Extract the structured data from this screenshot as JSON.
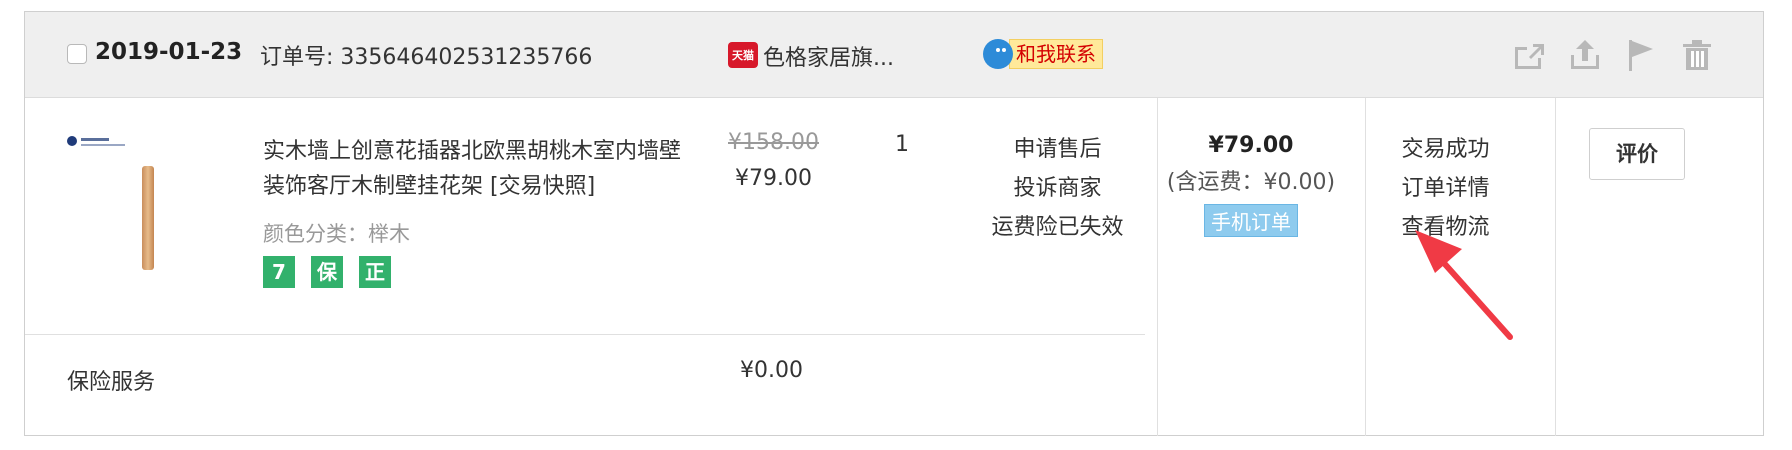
{
  "order": {
    "date": "2019-01-23",
    "order_number_text": "订单号: 335646402531235766",
    "shop_badge": "天猫",
    "shop_name": "色格家居旗...",
    "contact_label": "和我联系",
    "header_icons": [
      "share-icon",
      "upload-icon",
      "flag-icon",
      "trash-icon"
    ]
  },
  "item": {
    "title": "实木墙上创意花插器北欧黑胡桃木室内墙壁装饰客厅木制壁挂花架 [交易快照]",
    "attribute": "颜色分类：榉木",
    "service_badges": [
      "7",
      "保",
      "正"
    ],
    "original_price": "¥158.00",
    "price": "¥79.00",
    "quantity": "1",
    "after_sale_links": [
      "申请售后",
      "投诉商家",
      "运费险已失效"
    ]
  },
  "summary": {
    "total_price": "¥79.00",
    "shipping_text": "(含运费：¥0.00)",
    "mobile_badge": "手机订单"
  },
  "status_links": [
    "交易成功",
    "订单详情",
    "查看物流"
  ],
  "review_button": "评价",
  "insurance": {
    "label": "保险服务",
    "price": "¥0.00"
  },
  "colors": {
    "header_bg": "#efefef",
    "border": "#cfcfcf",
    "accent_arrow": "#f03a45",
    "service_green": "#32b16c"
  }
}
